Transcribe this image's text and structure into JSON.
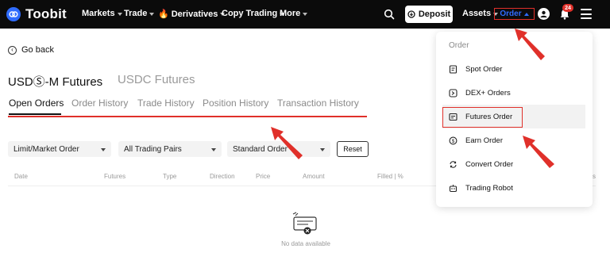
{
  "brand": {
    "name": "Toobit"
  },
  "topnav": {
    "items": [
      {
        "label": "Markets"
      },
      {
        "label": "Trade"
      },
      {
        "label": "Derivatives"
      },
      {
        "label": "Copy Trading"
      },
      {
        "label": "More"
      }
    ],
    "deposit_label": "Deposit",
    "assets_label": "Assets",
    "order_label": "Order",
    "notification_count": "24"
  },
  "page": {
    "go_back": "Go back",
    "market_tabs": [
      "USDⓈ-M Futures",
      "USDC Futures"
    ],
    "sub_tabs": [
      "Open Orders",
      "Order History",
      "Trade History",
      "Position History",
      "Transaction History"
    ],
    "active_sub_tab": "Open Orders",
    "filters": {
      "order_type": "Limit/Market Order",
      "pairs": "All Trading Pairs",
      "mode": "Standard Order",
      "reset": "Reset"
    },
    "columns": [
      "Date",
      "Futures",
      "Type",
      "Direction",
      "Price",
      "Amount",
      "Filled | %"
    ],
    "trailing_column_fragment": "s",
    "empty_text": "No data available"
  },
  "order_menu": {
    "title": "Order",
    "items": [
      {
        "label": "Spot Order",
        "icon": "spot-order-icon"
      },
      {
        "label": "DEX+ Orders",
        "icon": "dex-orders-icon"
      },
      {
        "label": "Futures Order",
        "icon": "futures-order-icon"
      },
      {
        "label": "Earn Order",
        "icon": "earn-order-icon"
      },
      {
        "label": "Convert Order",
        "icon": "convert-order-icon"
      },
      {
        "label": "Trading Robot",
        "icon": "trading-robot-icon"
      }
    ],
    "highlighted": "Futures Order"
  },
  "colors": {
    "topbar_bg": "#0b0b0b",
    "brand_blue": "#2f6cff",
    "annotation_red": "#e0302a"
  }
}
